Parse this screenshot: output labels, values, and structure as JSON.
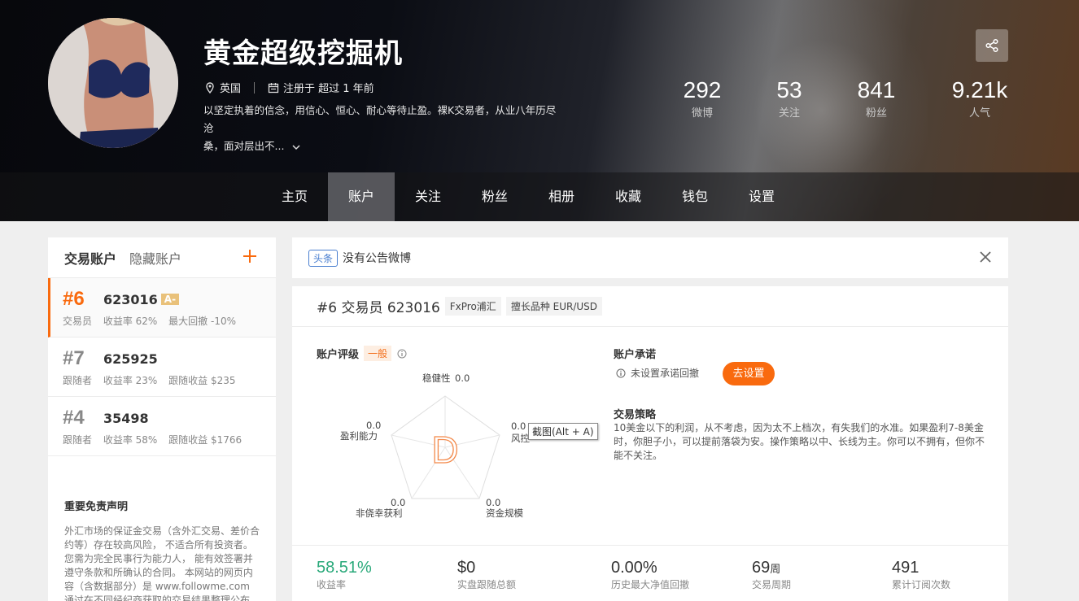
{
  "profile": {
    "name": "黄金超级挖掘机",
    "location": "英国",
    "registered": "注册于 超过 1 年前",
    "bio_line1": "以坚定执着的信念，用信心、恒心、耐心等待止盈。裸K交易者，从业八年历尽沧",
    "bio_line2": "桑，面对层出不..."
  },
  "stats": [
    {
      "value": "292",
      "label": "微博"
    },
    {
      "value": "53",
      "label": "关注"
    },
    {
      "value": "841",
      "label": "粉丝"
    },
    {
      "value": "9.21k",
      "label": "人气"
    }
  ],
  "nav": [
    "主页",
    "账户",
    "关注",
    "粉丝",
    "相册",
    "收藏",
    "钱包",
    "设置"
  ],
  "nav_active": "账户",
  "account_tabs": {
    "trading": "交易账户",
    "hidden": "隐藏账户"
  },
  "accounts": [
    {
      "rank": "#6",
      "number": "623016",
      "grade": "A-",
      "role": "交易员",
      "metric1": "收益率 62%",
      "metric2": "最大回撤 -10%"
    },
    {
      "rank": "#7",
      "number": "625925",
      "grade": "",
      "role": "跟随者",
      "metric1": "收益率 23%",
      "metric2": "跟随收益 $235"
    },
    {
      "rank": "#4",
      "number": "35498",
      "grade": "",
      "role": "跟随者",
      "metric1": "收益率 58%",
      "metric2": "跟随收益 $1766"
    }
  ],
  "disclaimer": {
    "title": "重要免责声明",
    "text": "外汇市场的保证金交易（含外汇交易、差价合约等）存在较高风险， 不适合所有投资者。您需为完全民事行为能力人， 能有效签署并遵守条款和所确认的合同。 本网站的网页内容（含数据部分）是 www.followme.com 通过在不同经纪商获取的交易结果整理公布"
  },
  "notice": {
    "tag": "头条",
    "text": "没有公告微博"
  },
  "account_header": {
    "title": "#6 交易员 623016",
    "broker": "FxPro浦汇",
    "instrument": "擅长品种 EUR/USD"
  },
  "rating": {
    "label": "账户评级",
    "level": "一般",
    "grade_letter": "D",
    "axes": [
      {
        "name": "稳健性",
        "value": "0.0"
      },
      {
        "name": "风控",
        "value": "0.0"
      },
      {
        "name": "资金规模",
        "value": "0.0"
      },
      {
        "name": "非侥幸获利",
        "value": "0.0"
      },
      {
        "name": "盈利能力",
        "value": "0.0"
      }
    ],
    "tooltip": "截图(Alt + A)"
  },
  "promise": {
    "title": "账户承诺",
    "text": "未设置承诺回撤",
    "button": "去设置"
  },
  "strategy": {
    "title": "交易策略",
    "text": "10美金以下的利润，从不考虑，因为太不上档次，有失我们的水准。如果盈利7-8美金时，你胆子小，可以提前落袋为安。操作策略以中、长线为主。你可以不拥有，但你不能不关注。"
  },
  "metrics": [
    {
      "value": "58.51%",
      "unit": "",
      "label": "收益率"
    },
    {
      "value": "$0",
      "unit": "",
      "label": "实盘跟随总额"
    },
    {
      "value": "0.00%",
      "unit": "",
      "label": "历史最大净值回撤"
    },
    {
      "value": "69",
      "unit": "周",
      "label": "交易周期"
    },
    {
      "value": "491",
      "unit": "",
      "label": "累计订阅次数"
    }
  ],
  "colors": {
    "accent": "#f96a0e",
    "green": "#2aa97a",
    "blue": "#4a7fd0"
  }
}
